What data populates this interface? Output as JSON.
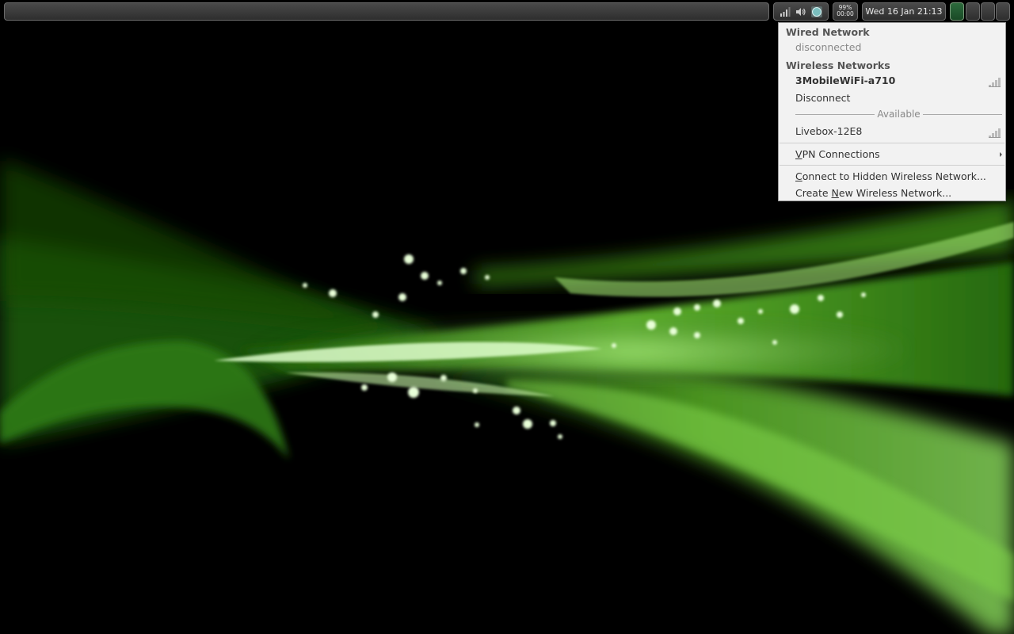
{
  "panel": {
    "battery": {
      "percent": "99%",
      "time": "00:00"
    },
    "clock": "Wed 16 Jan 21:13",
    "tray_icons": [
      "network-signal-icon",
      "volume-icon",
      "network-manager-icon"
    ],
    "workspaces": [
      {
        "name": "workspace-1",
        "active": true
      },
      {
        "name": "workspace-2",
        "active": false
      },
      {
        "name": "workspace-3",
        "active": false
      },
      {
        "name": "workspace-4",
        "active": false
      }
    ]
  },
  "network_menu": {
    "wired": {
      "header": "Wired Network",
      "status": "disconnected"
    },
    "wireless": {
      "header": "Wireless Networks",
      "connected": {
        "ssid": "3MobileWiFi-a710",
        "icon": "wifi-signal-icon"
      },
      "disconnect_label": "Disconnect",
      "available_label": "Available",
      "available": [
        {
          "ssid": "Livebox-12E8",
          "icon": "wifi-signal-icon"
        }
      ]
    },
    "vpn": {
      "accel": "V",
      "rest": "PN Connections"
    },
    "hidden": {
      "accel": "C",
      "rest": "onnect to Hidden Wireless Network..."
    },
    "create": {
      "pre": "Create ",
      "accel": "N",
      "rest": "ew Wireless Network..."
    }
  },
  "colors": {
    "wallpaper_accent": "#5fbf2a",
    "menu_bg": "#f2f2f2",
    "panel_bg": "#3a3a3a"
  }
}
